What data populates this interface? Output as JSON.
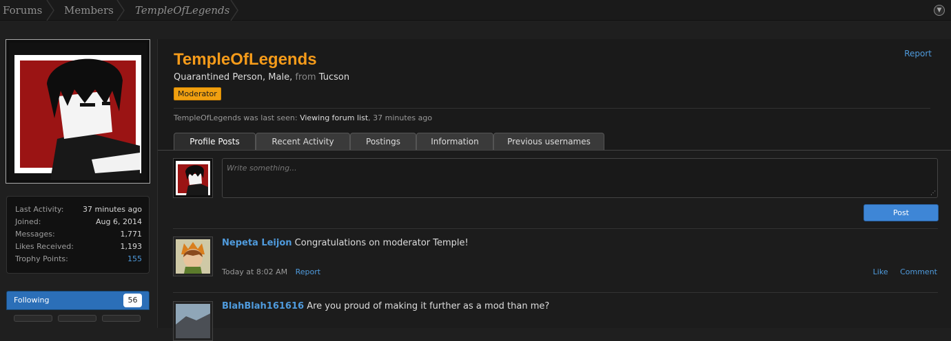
{
  "breadcrumb": {
    "items": [
      "Forums",
      "Members",
      "TempleOfLegends"
    ]
  },
  "profile": {
    "username": "TempleOfLegends",
    "custom_title": "Quarantined Person",
    "gender": "Male",
    "from_label": "from",
    "location": "Tucson",
    "banner": "Moderator",
    "report_label": "Report",
    "last_seen": {
      "prefix": "TempleOfLegends was last seen:",
      "activity": "Viewing forum list",
      "time": "37 minutes ago"
    }
  },
  "tabs": [
    {
      "label": "Profile Posts",
      "active": true
    },
    {
      "label": "Recent Activity",
      "active": false
    },
    {
      "label": "Postings",
      "active": false
    },
    {
      "label": "Information",
      "active": false
    },
    {
      "label": "Previous usernames",
      "active": false
    }
  ],
  "stats": [
    {
      "label": "Last Activity:",
      "value": "37 minutes ago"
    },
    {
      "label": "Joined:",
      "value": "Aug 6, 2014"
    },
    {
      "label": "Messages:",
      "value": "1,771"
    },
    {
      "label": "Likes Received:",
      "value": "1,193"
    },
    {
      "label": "Trophy Points:",
      "value": "155"
    }
  ],
  "following": {
    "label": "Following",
    "count": "56"
  },
  "composer": {
    "placeholder": "Write something...",
    "post_label": "Post"
  },
  "posts": [
    {
      "author": "Nepeta Leijon",
      "message": "Congratulations on moderator Temple!",
      "time": "Today at 8:02 AM",
      "report": "Report",
      "like": "Like",
      "comment": "Comment"
    },
    {
      "author": "BlahBlah161616",
      "message": "Are you proud of making it further as a mod than me?"
    }
  ],
  "colors": {
    "accent_orange": "#f59b1a",
    "link_blue": "#4f9bdd",
    "button_blue": "#3e86d6",
    "background": "#1f1f1f"
  },
  "icons": {
    "jump_menu": "circle-chevron-down-icon"
  }
}
